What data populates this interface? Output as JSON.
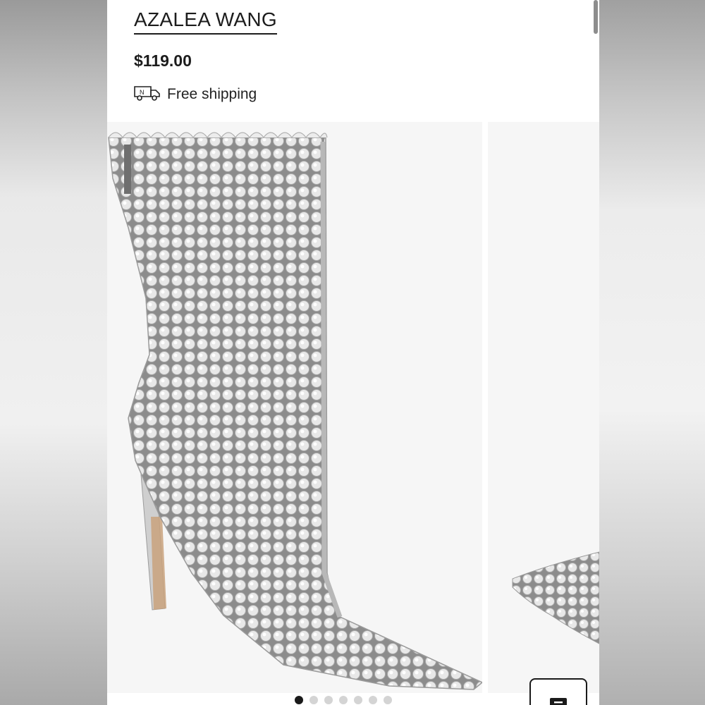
{
  "product": {
    "brand": "AZALEA WANG",
    "price": "$119.00",
    "shipping_label": "Free shipping"
  },
  "icons": {
    "shipping": "delivery-truck-icon",
    "fab": "bag-icon"
  },
  "gallery": {
    "image_count": 7,
    "active_index": 0
  },
  "colors": {
    "text": "#1c1c1c",
    "active_dot": "#1a1a1a",
    "inactive_dot": "#d4d4d4"
  }
}
